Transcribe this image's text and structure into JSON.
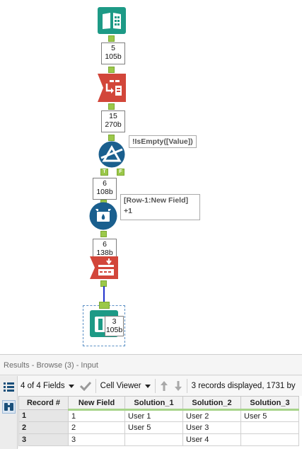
{
  "workflow": {
    "tools": [
      {
        "id": "input",
        "name": "Input Data"
      },
      {
        "id": "select",
        "name": "Select"
      },
      {
        "id": "filter",
        "name": "Filter",
        "annotation": "!IsEmpty([Value])"
      },
      {
        "id": "multirow",
        "name": "Multi-Row Formula",
        "annotation_line1": "[Row-1:New Field]",
        "annotation_line2": "+1"
      },
      {
        "id": "crosstab",
        "name": "Cross Tab"
      },
      {
        "id": "browse",
        "name": "Browse"
      }
    ],
    "counts": [
      {
        "records": "5",
        "bytes": "105b"
      },
      {
        "records": "15",
        "bytes": "270b"
      },
      {
        "records": "6",
        "bytes": "108b"
      },
      {
        "records": "6",
        "bytes": "138b"
      },
      {
        "records": "3",
        "bytes": "105b"
      }
    ],
    "filter_true_anchor": "T",
    "filter_false_anchor": "F",
    "colors": {
      "tool_teal": "#1d9a86",
      "tool_red": "#d2463a",
      "tool_blue": "#1a5f8e",
      "anchor_green": "#9bc84a",
      "connection_blue": "#2233cc"
    }
  },
  "results": {
    "title": "Results - Browse (3) - Input",
    "toolbar": {
      "fields_label": "4 of 4 Fields",
      "cell_viewer_label": "Cell Viewer",
      "status": "3 records displayed, 1731 by"
    },
    "table": {
      "headers": [
        "Record #",
        "New Field",
        "Solution_1",
        "Solution_2",
        "Solution_3"
      ],
      "rows": [
        [
          "1",
          "1",
          "User 1",
          "User 2",
          "User 5"
        ],
        [
          "2",
          "2",
          "User 5",
          "User 3",
          ""
        ],
        [
          "3",
          "3",
          "",
          "User 4",
          ""
        ]
      ]
    }
  }
}
